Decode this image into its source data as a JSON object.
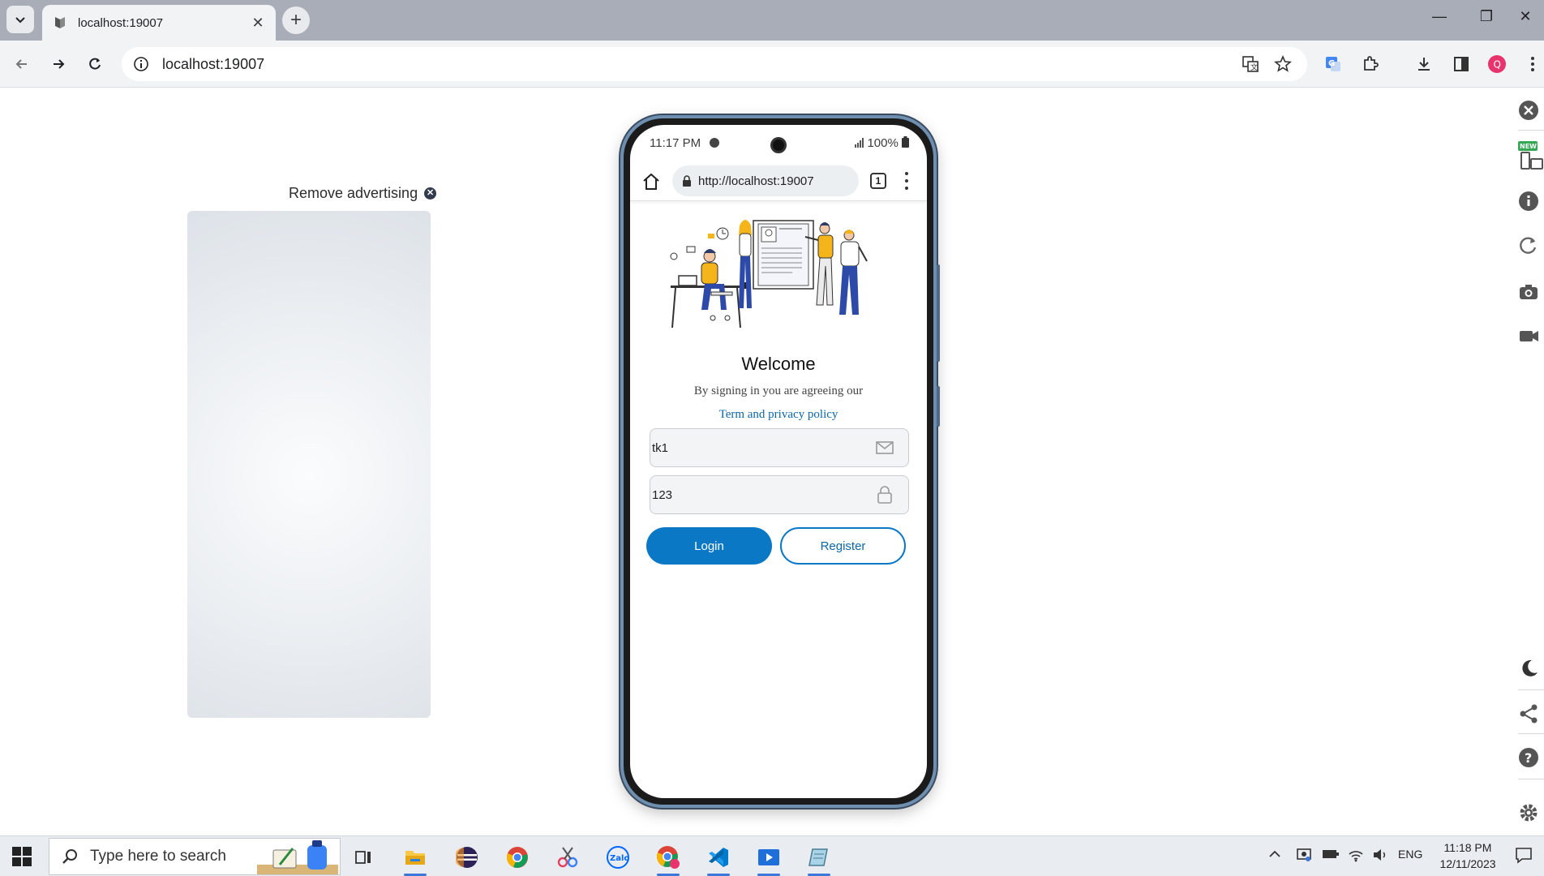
{
  "browser": {
    "tab_title": "localhost:19007",
    "url": "localhost:19007"
  },
  "ad": {
    "remove_label": "Remove advertising"
  },
  "phone": {
    "status": {
      "time": "11:17 PM",
      "battery": "100%"
    },
    "mobile_url": "http://localhost:19007",
    "tab_count": "1",
    "login": {
      "title": "Welcome",
      "agree_text": "By signing in you are agreeing our",
      "terms_link": "Term and privacy policy",
      "username_value": "tk1",
      "password_value": "123",
      "login_button": "Login",
      "register_button": "Register"
    }
  },
  "taskbar": {
    "search_placeholder": "Type here to search",
    "language": "ENG",
    "time": "11:18 PM",
    "date": "12/11/2023"
  },
  "colors": {
    "primary": "#0b78c6",
    "tabstrip": "#a8adb8",
    "phone_frame": "#6e8fb0"
  },
  "side_toolbar": {
    "badge": "NEW"
  }
}
